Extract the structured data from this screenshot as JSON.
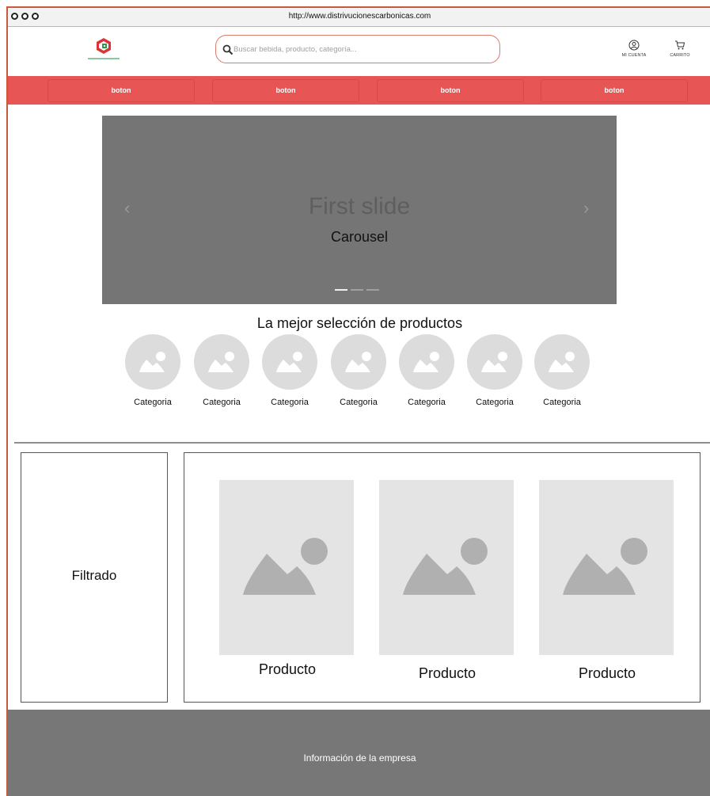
{
  "browser": {
    "url": "http://www.distrivucionescarbonicas.com"
  },
  "header": {
    "search_placeholder": "Buscar bebida, producto, categoría...",
    "account_label": "MI CUENTA",
    "cart_label": "CARRITO"
  },
  "nav": {
    "buttons": [
      "boton",
      "boton",
      "boton",
      "boton"
    ]
  },
  "carousel": {
    "slide_title": "First slide",
    "slide_caption": "Carousel",
    "slide_count": 3,
    "active_slide": 1
  },
  "categories": {
    "title": "La mejor selección de productos",
    "items": [
      "Categoria",
      "Categoria",
      "Categoria",
      "Categoria",
      "Categoria",
      "Categoria",
      "Categoria"
    ]
  },
  "filter": {
    "label": "Filtrado"
  },
  "products": {
    "items": [
      "Producto",
      "Producto",
      "Producto"
    ]
  },
  "footer": {
    "text": "Información de la empresa"
  },
  "colors": {
    "accent": "#e85555",
    "logo_red": "#d9343a",
    "logo_green": "#2a9d4a",
    "footer_bg": "#777777",
    "carousel_bg": "#757575"
  }
}
